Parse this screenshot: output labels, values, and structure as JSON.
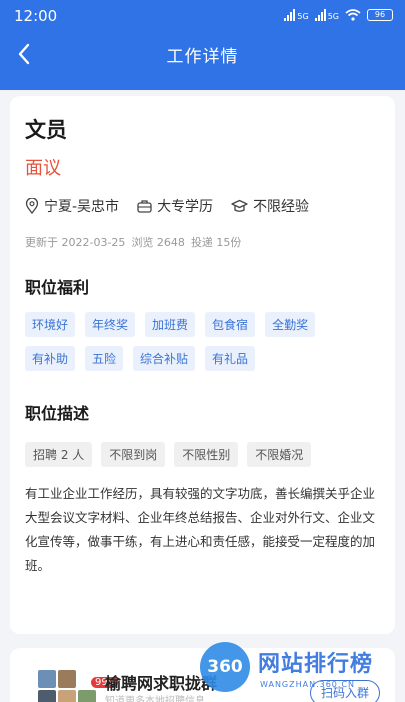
{
  "status_bar": {
    "time": "12:00",
    "network1": "5G",
    "network2": "5G",
    "battery": "96"
  },
  "nav": {
    "title": "工作详情"
  },
  "job": {
    "title": "文员",
    "salary": "面议",
    "location": "宁夏-吴忠市",
    "education": "大专学历",
    "experience": "不限经验",
    "updated": "更新于 2022-03-25",
    "views": "浏览 2648",
    "applications": "投递 15份"
  },
  "benefits": {
    "title": "职位福利",
    "tags": [
      "环境好",
      "年终奖",
      "加班费",
      "包食宿",
      "全勤奖",
      "有补助",
      "五险",
      "综合补贴",
      "有礼品"
    ]
  },
  "description": {
    "title": "职位描述",
    "requirements": [
      "招聘 2 人",
      "不限到岗",
      "不限性别",
      "不限婚况"
    ],
    "text": "有工业企业工作经历，具有较强的文字功底，善长编撰关乎企业大型会议文字材料、企业年终总结报告、企业对外行文、企业文化宣传等，做事干练，有上进心和责任感，能接受一定程度的加班。"
  },
  "banner": {
    "title": "榆聘网求职拢群",
    "subtitle": "知道更多本地招聘信息",
    "badge": "999",
    "button": "扫码入群"
  },
  "watermark": {
    "logo": "360",
    "name": "网站排行榜",
    "url": "WANGZHAN.360.CN"
  },
  "colors": {
    "primary": "#2f73e6",
    "salary": "#e4533a",
    "benefit_text": "#3a73d6"
  }
}
